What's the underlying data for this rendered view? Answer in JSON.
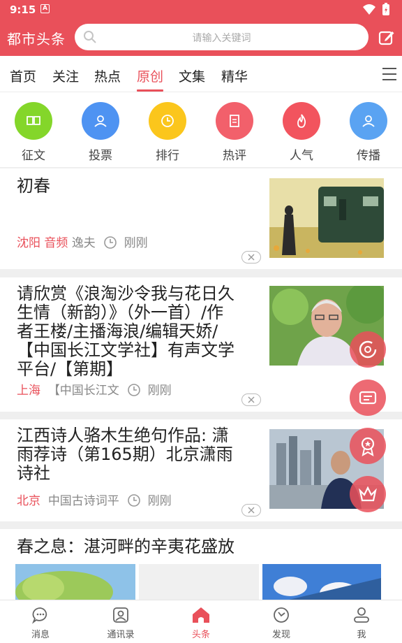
{
  "status": {
    "time": "9:15",
    "notification_glyph": "A"
  },
  "header": {
    "app_title": "都市头条",
    "search_placeholder": "请输入关键词"
  },
  "tabs": [
    {
      "label": "首页"
    },
    {
      "label": "关注"
    },
    {
      "label": "热点"
    },
    {
      "label": "原创",
      "active": true
    },
    {
      "label": "文集"
    },
    {
      "label": "精华"
    }
  ],
  "categories": [
    {
      "label": "征文",
      "icon": "book-icon",
      "color": "#84d62a"
    },
    {
      "label": "投票",
      "icon": "vote-icon",
      "color": "#4e93f2"
    },
    {
      "label": "排行",
      "icon": "clock-icon",
      "color": "#fbc61c"
    },
    {
      "label": "热评",
      "icon": "document-icon",
      "color": "#f2606b"
    },
    {
      "label": "人气",
      "icon": "flame-icon",
      "color": "#f2545e"
    },
    {
      "label": "传播",
      "icon": "user-icon",
      "color": "#5aa3f2"
    }
  ],
  "articles": [
    {
      "title": "初春",
      "location": "沈阳",
      "source": "音频",
      "author": "逸夫",
      "time": "刚刚"
    },
    {
      "title_lines": [
        "请欣赏《浪淘沙令我与花日久",
        "生情（新韵）》（外一首）/作",
        "者王楼/主播海浪/编辑天娇/",
        "【中国长江文学社】有声文学",
        "平台/【第期】"
      ],
      "location": "上海",
      "author": "【中国长江文",
      "time": "刚刚"
    },
    {
      "title_lines": [
        "江西诗人骆木生绝句作品: 潇",
        "雨荐诗（第165期）北京潇雨",
        "诗社"
      ],
      "location": "北京",
      "author": "中国古诗词平",
      "time": "刚刚"
    },
    {
      "title": "春之息：湛河畔的辛夷花盛放"
    }
  ],
  "bottom_nav": [
    {
      "label": "消息",
      "icon": "chat-icon"
    },
    {
      "label": "通讯录",
      "icon": "contacts-icon"
    },
    {
      "label": "头条",
      "icon": "home-icon",
      "active": true
    },
    {
      "label": "发现",
      "icon": "compass-icon"
    },
    {
      "label": "我",
      "icon": "profile-icon"
    }
  ],
  "colors": {
    "brand": "#e9505a",
    "text": "#222222",
    "muted": "#888888"
  }
}
